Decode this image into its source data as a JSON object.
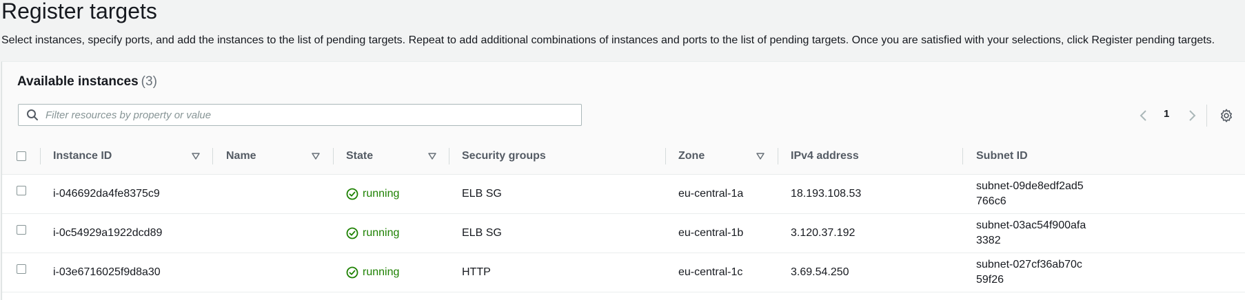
{
  "header": {
    "title": "Register targets",
    "description": "Select instances, specify ports, and add the instances to the list of pending targets. Repeat to add additional combinations of instances and ports to the list of pending targets. Once you are satisfied with your selections, click Register pending targets."
  },
  "panel": {
    "title": "Available instances",
    "count": "(3)",
    "filter_placeholder": "Filter resources by property or value",
    "filter_value": "",
    "page_number": "1"
  },
  "table": {
    "columns": {
      "instance_id": "Instance ID",
      "name": "Name",
      "state": "State",
      "security_groups": "Security groups",
      "zone": "Zone",
      "ipv4": "IPv4 address",
      "subnet_id": "Subnet ID"
    },
    "rows": [
      {
        "instance_id": "i-046692da4fe8375c9",
        "name": "",
        "state": "running",
        "security_groups": "ELB SG",
        "zone": "eu-central-1a",
        "ipv4": "18.193.108.53",
        "subnet_id": "subnet-09de8edf2ad5766c6"
      },
      {
        "instance_id": "i-0c54929a1922dcd89",
        "name": "",
        "state": "running",
        "security_groups": "ELB SG",
        "zone": "eu-central-1b",
        "ipv4": "3.120.37.192",
        "subnet_id": "subnet-03ac54f900afa3382"
      },
      {
        "instance_id": "i-03e6716025f9d8a30",
        "name": "",
        "state": "running",
        "security_groups": "HTTP",
        "zone": "eu-central-1c",
        "ipv4": "3.69.54.250",
        "subnet_id": "subnet-027cf36ab70c59f26"
      }
    ]
  },
  "icons": {
    "search": "search-icon",
    "prev": "chevron-left-icon",
    "next": "chevron-right-icon",
    "settings": "gear-icon",
    "sort": "caret-down-icon",
    "status": "check-circle-icon"
  },
  "colors": {
    "running": "#1d8102",
    "background": "#f2f3f3",
    "panel": "#ffffff"
  }
}
